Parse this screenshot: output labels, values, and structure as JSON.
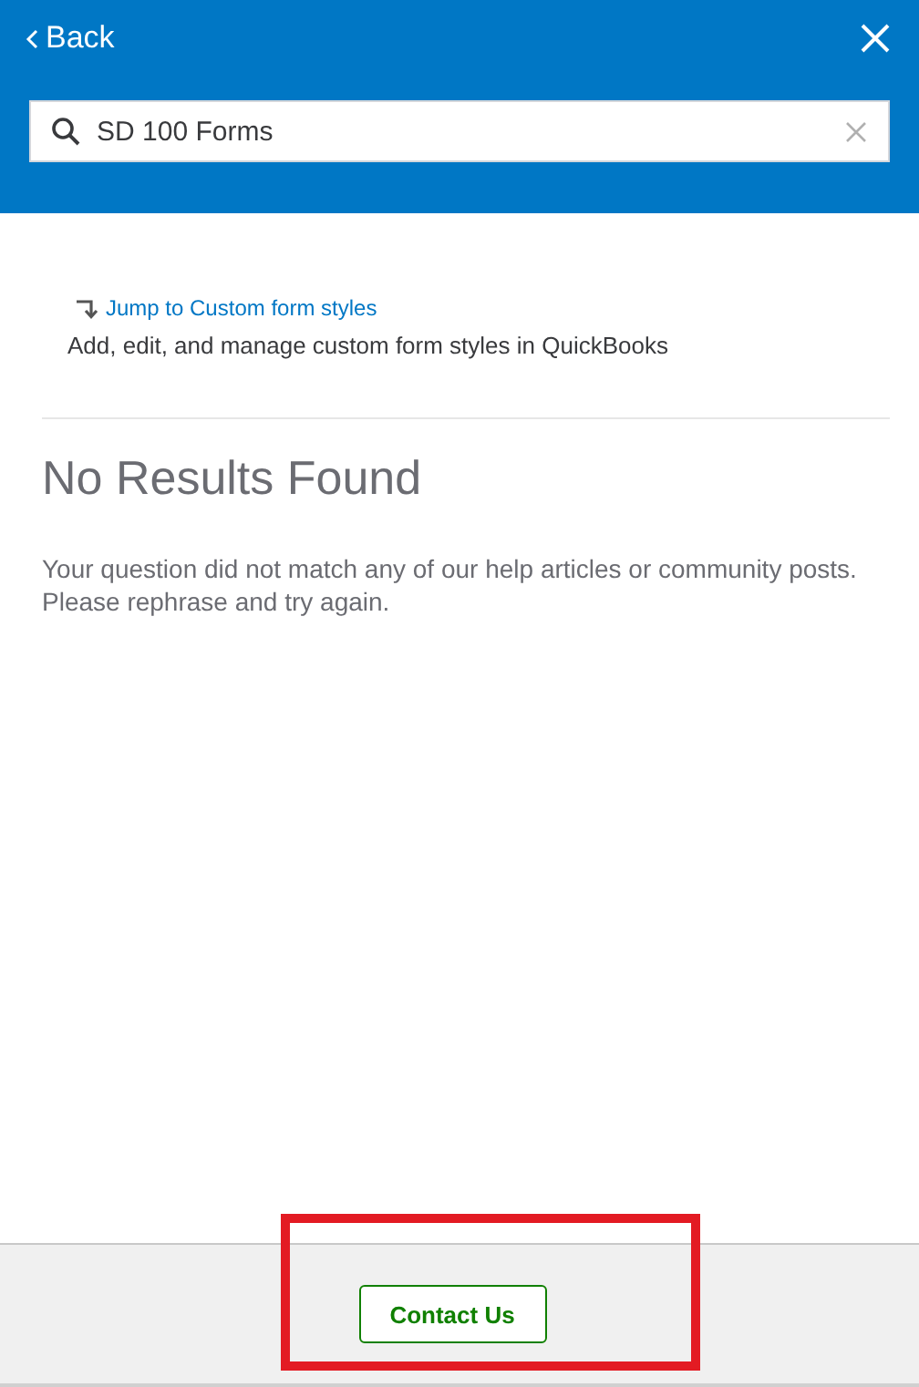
{
  "header": {
    "back_label": "Back"
  },
  "search": {
    "value": "SD 100 Forms"
  },
  "jump_link": {
    "label": "Jump to Custom form styles",
    "description": "Add, edit, and manage custom form styles in QuickBooks"
  },
  "results": {
    "title": "No Results Found",
    "message": "Your question did not match any of our help articles or community posts. Please rephrase and try again."
  },
  "footer": {
    "button": "Contact Us"
  }
}
